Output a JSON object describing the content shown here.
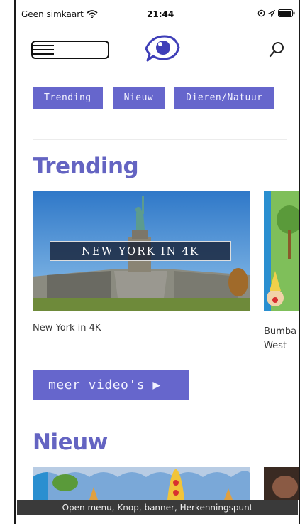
{
  "status_bar": {
    "carrier": "Geen simkaart",
    "time": "21:44"
  },
  "nav": {
    "logo_icon": "eye-icon",
    "search_icon": "search-icon",
    "menu_icon": "hamburger-menu-icon"
  },
  "categories": [
    {
      "label": "Trending"
    },
    {
      "label": "Nieuw"
    },
    {
      "label": "Dieren/Natuur"
    }
  ],
  "sections": {
    "trending": {
      "title": "Trending",
      "cards": [
        {
          "title": "New York in 4K",
          "thumb_text": "New York in 4K"
        },
        {
          "title": "Bumba West"
        }
      ],
      "more_label": "meer video's ▶"
    },
    "nieuw": {
      "title": "Nieuw"
    }
  },
  "accessibility_banner": "Open menu, Knop, banner, Herkenningspunt",
  "colors": {
    "accent": "#6666cc",
    "title": "#6464c2"
  }
}
